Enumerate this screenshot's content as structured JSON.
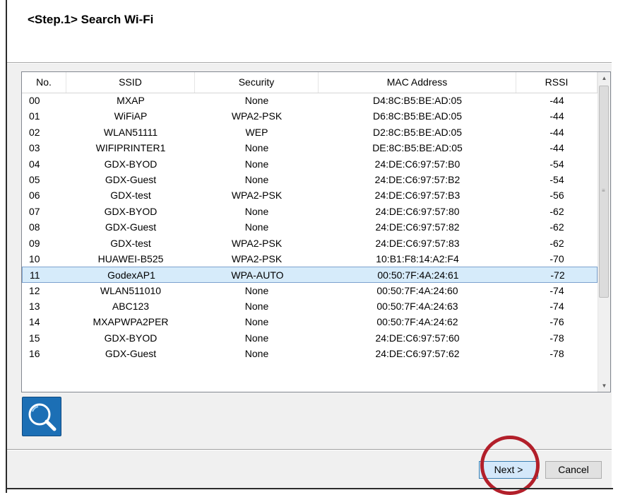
{
  "header": {
    "title": "<Step.1>  Search Wi-Fi"
  },
  "table": {
    "columns": [
      "No.",
      "SSID",
      "Security",
      "MAC Address",
      "RSSI"
    ],
    "rows": [
      {
        "no": "00",
        "ssid": "MXAP",
        "security": "None",
        "mac": "D4:8C:B5:BE:AD:05",
        "rssi": "-44"
      },
      {
        "no": "01",
        "ssid": "WiFiAP",
        "security": "WPA2-PSK",
        "mac": "D6:8C:B5:BE:AD:05",
        "rssi": "-44"
      },
      {
        "no": "02",
        "ssid": "WLAN51111",
        "security": "WEP",
        "mac": "D2:8C:B5:BE:AD:05",
        "rssi": "-44"
      },
      {
        "no": "03",
        "ssid": "WIFIPRINTER1",
        "security": "None",
        "mac": "DE:8C:B5:BE:AD:05",
        "rssi": "-44"
      },
      {
        "no": "04",
        "ssid": "GDX-BYOD",
        "security": "None",
        "mac": "24:DE:C6:97:57:B0",
        "rssi": "-54"
      },
      {
        "no": "05",
        "ssid": "GDX-Guest",
        "security": "None",
        "mac": "24:DE:C6:97:57:B2",
        "rssi": "-54"
      },
      {
        "no": "06",
        "ssid": "GDX-test",
        "security": "WPA2-PSK",
        "mac": "24:DE:C6:97:57:B3",
        "rssi": "-56"
      },
      {
        "no": "07",
        "ssid": "GDX-BYOD",
        "security": "None",
        "mac": "24:DE:C6:97:57:80",
        "rssi": "-62"
      },
      {
        "no": "08",
        "ssid": "GDX-Guest",
        "security": "None",
        "mac": "24:DE:C6:97:57:82",
        "rssi": "-62"
      },
      {
        "no": "09",
        "ssid": "GDX-test",
        "security": "WPA2-PSK",
        "mac": "24:DE:C6:97:57:83",
        "rssi": "-62"
      },
      {
        "no": "10",
        "ssid": "HUAWEI-B525",
        "security": "WPA2-PSK",
        "mac": "10:B1:F8:14:A2:F4",
        "rssi": "-70"
      },
      {
        "no": "11",
        "ssid": "GodexAP1",
        "security": "WPA-AUTO",
        "mac": "00:50:7F:4A:24:61",
        "rssi": "-72",
        "selected": true
      },
      {
        "no": "12",
        "ssid": "WLAN511010",
        "security": "None",
        "mac": "00:50:7F:4A:24:60",
        "rssi": "-74"
      },
      {
        "no": "13",
        "ssid": "ABC123",
        "security": "None",
        "mac": "00:50:7F:4A:24:63",
        "rssi": "-74"
      },
      {
        "no": "14",
        "ssid": "MXAPWPA2PER",
        "security": "None",
        "mac": "00:50:7F:4A:24:62",
        "rssi": "-76"
      },
      {
        "no": "15",
        "ssid": "GDX-BYOD",
        "security": "None",
        "mac": "24:DE:C6:97:57:60",
        "rssi": "-78"
      },
      {
        "no": "16",
        "ssid": "GDX-Guest",
        "security": "None",
        "mac": "24:DE:C6:97:57:62",
        "rssi": "-78"
      }
    ]
  },
  "scrollbar": {
    "up_icon": "▲",
    "down_icon": "▼",
    "grip_icon": "≡"
  },
  "search_button": {
    "icon": "magnifier-icon",
    "color": "#1c6fb5"
  },
  "footer": {
    "next_label": "Next >",
    "cancel_label": "Cancel"
  },
  "annotation": {
    "circle_color": "#b21f2a"
  }
}
